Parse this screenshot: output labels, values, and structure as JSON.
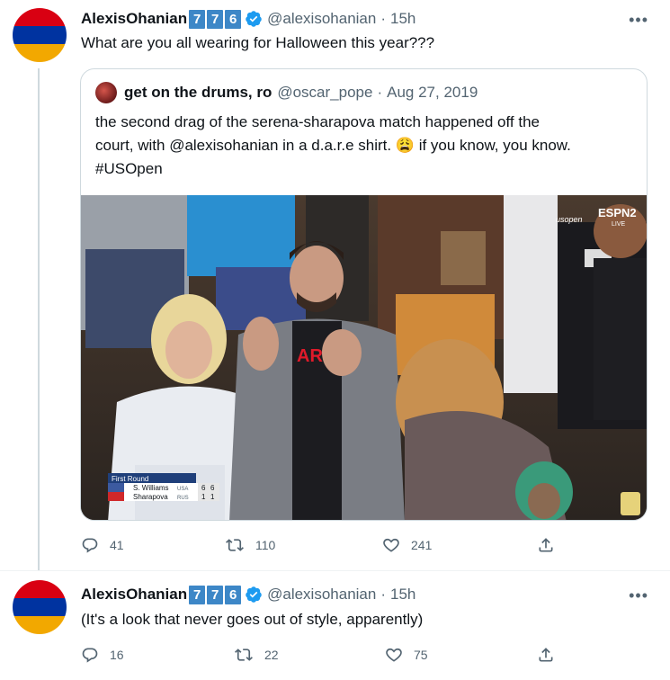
{
  "tweet1": {
    "name": "AlexisOhanian",
    "badge_digits": [
      "7",
      "7",
      "6"
    ],
    "handle": "@alexisohanian",
    "time": "15h",
    "text": "What are you all wearing for Halloween this year???",
    "more": "•••",
    "quote": {
      "name": "get on the drums, ro",
      "handle": "@oscar_pope",
      "date": "Aug 27, 2019",
      "text_line1": "the second drag of the serena-sharapova match happened off the",
      "text_line2": "court, with @alexisohanian in a d.a.r.e shirt. 😩 if you know, you know.",
      "text_line3": "#USOpen",
      "media": {
        "broadcast_logo": "ESPN2",
        "broadcast_sub": "LIVE",
        "event_logo": "usopen",
        "scoreboard": {
          "round": "First Round",
          "player1": "S. Williams",
          "player1_country": "USA",
          "player1_sets": [
            "6",
            "6"
          ],
          "player2": "Sharapova",
          "player2_country": "RUS",
          "player2_sets": [
            "1",
            "1"
          ]
        }
      }
    },
    "replies": "41",
    "retweets": "110",
    "likes": "241"
  },
  "tweet2": {
    "name": "AlexisOhanian",
    "badge_digits": [
      "7",
      "7",
      "6"
    ],
    "handle": "@alexisohanian",
    "time": "15h",
    "text": "(It's a look that never goes out of style, apparently)",
    "more": "•••",
    "replies": "16",
    "retweets": "22",
    "likes": "75"
  },
  "colors": {
    "flag_red": "#d90012",
    "flag_blue": "#0033a0",
    "flag_orange": "#f2a800",
    "badge_blue": "#3d87c7",
    "verified_blue": "#1d9bf0",
    "secondary_text": "#536471"
  },
  "icons": {
    "verified": "verified-badge-icon",
    "reply": "reply-icon",
    "retweet": "retweet-icon",
    "like": "heart-icon",
    "share": "share-icon",
    "more": "more-icon"
  }
}
